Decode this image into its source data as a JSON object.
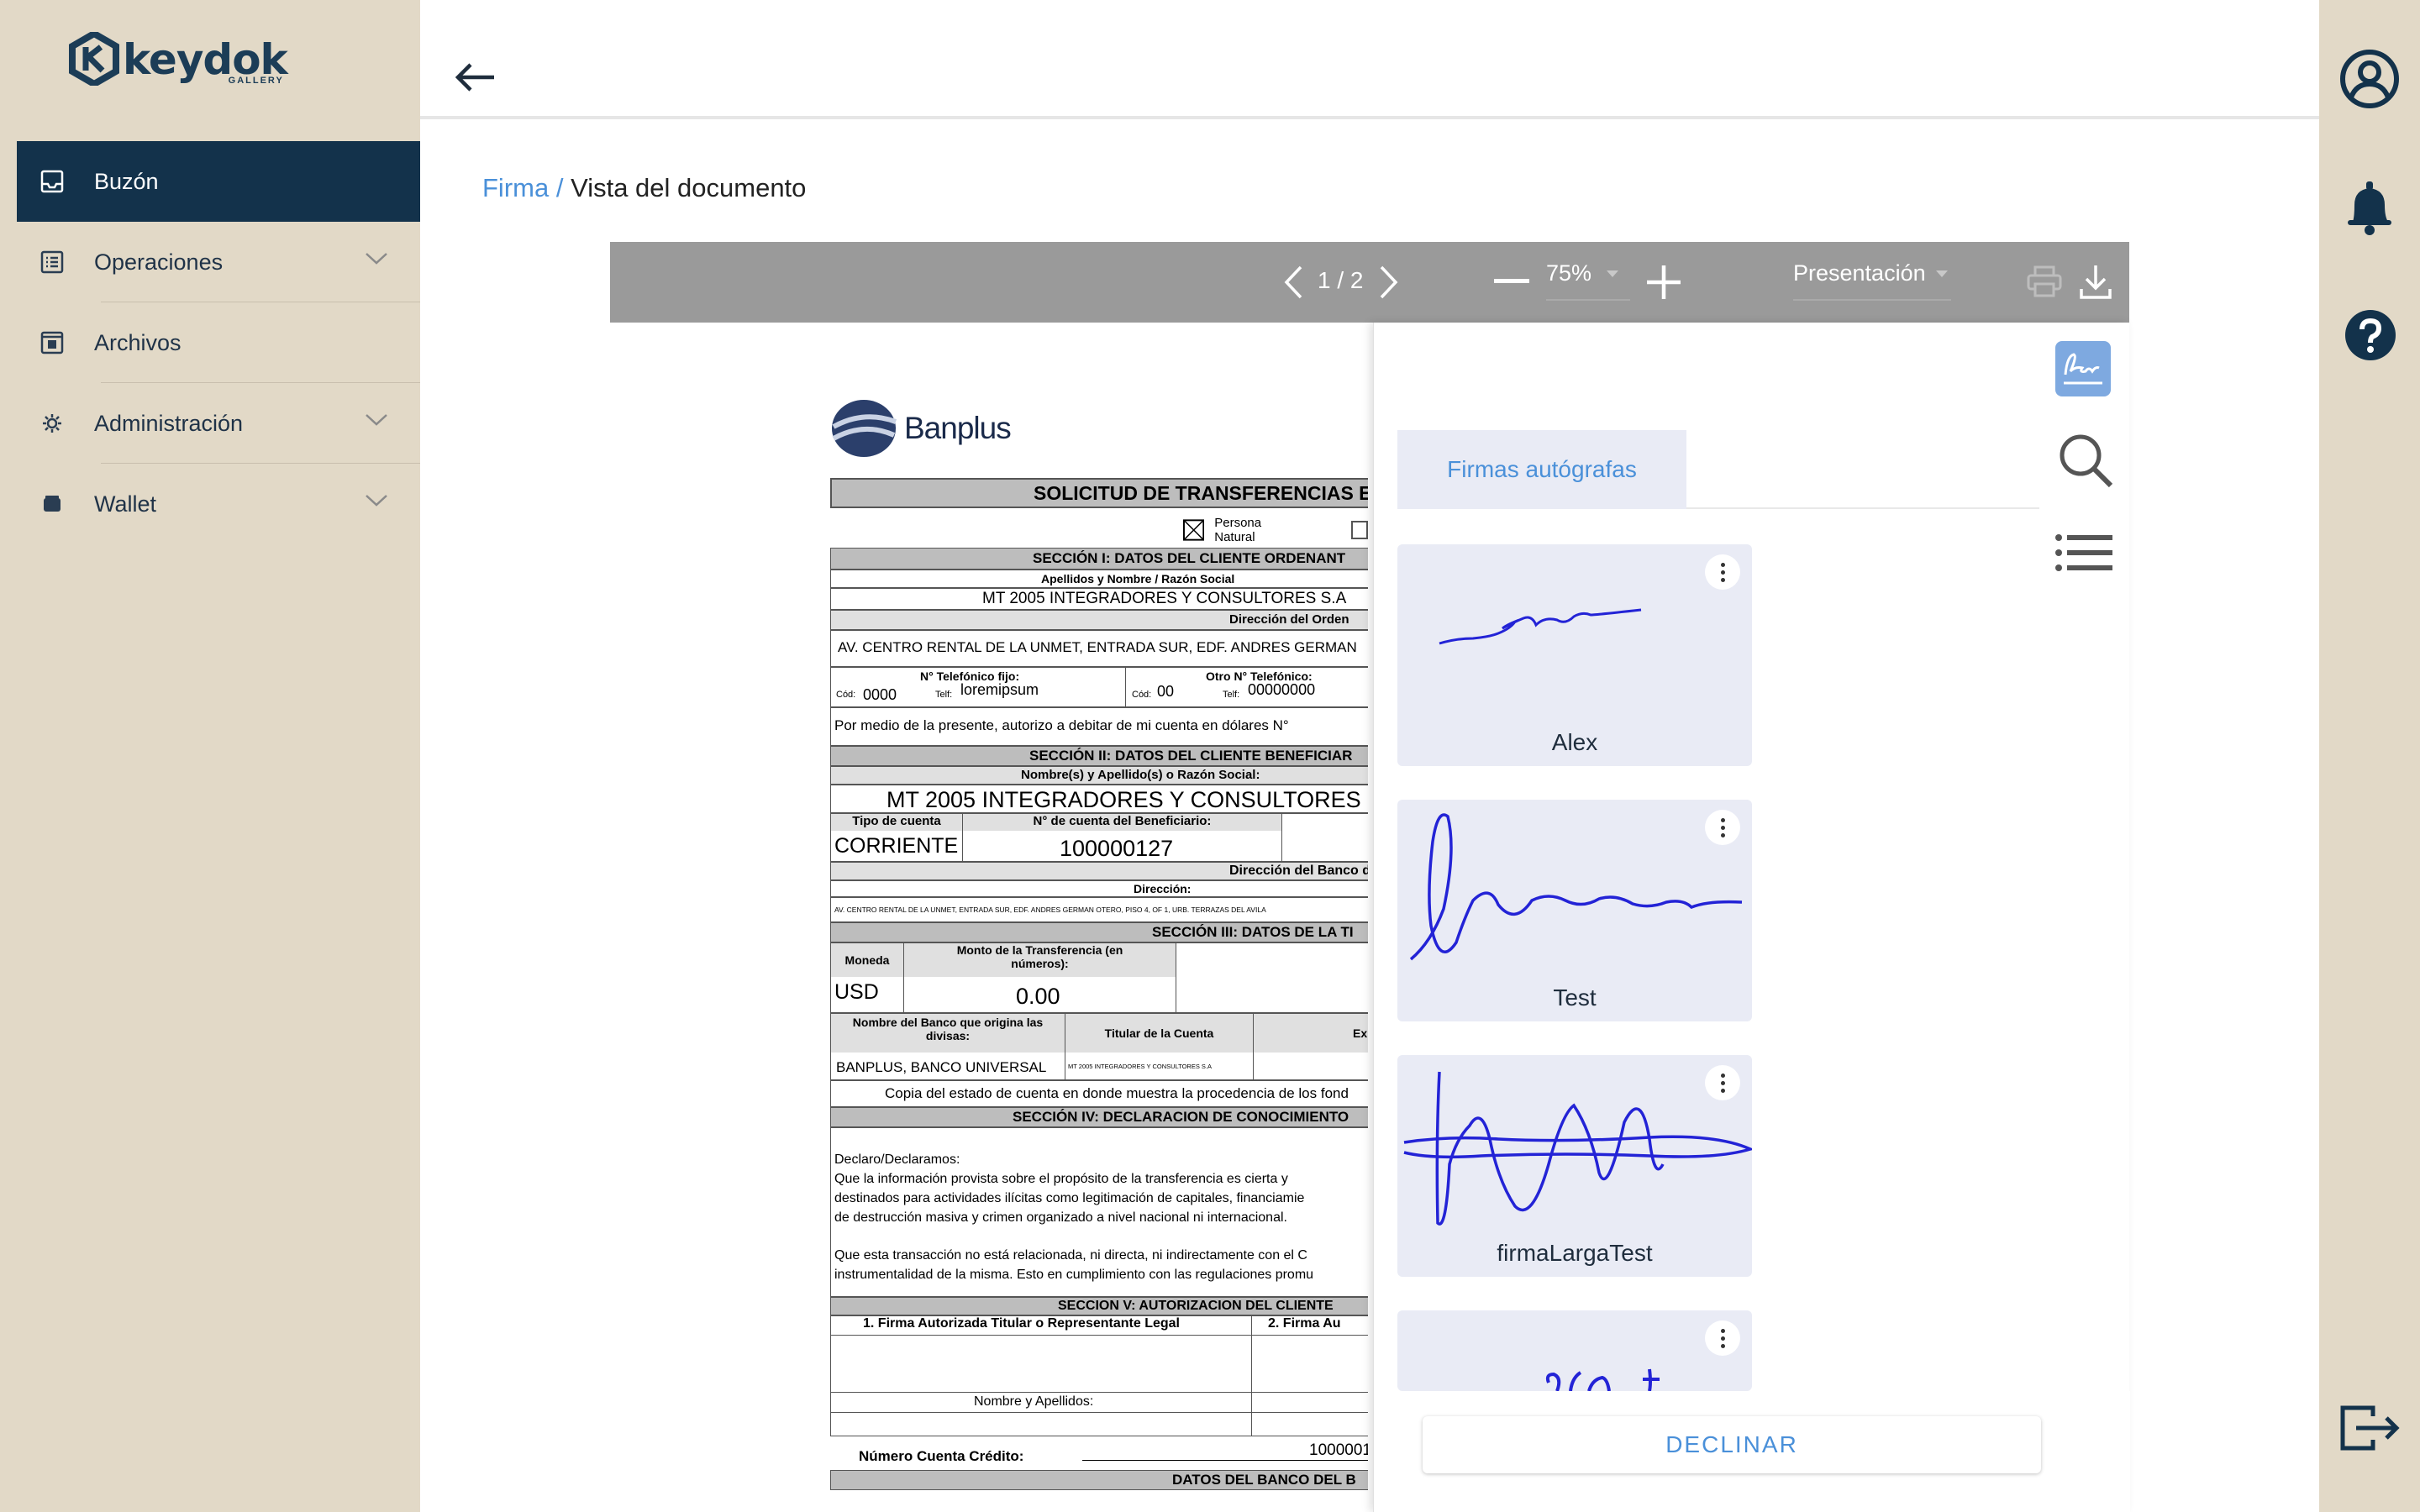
{
  "app": {
    "logo_text": "keydok",
    "logo_sub": "GALLERY"
  },
  "sidebar": {
    "items": [
      {
        "label": "Buzón",
        "icon": "inbox-icon",
        "active": true,
        "expandable": false
      },
      {
        "label": "Operaciones",
        "icon": "list-icon",
        "active": false,
        "expandable": true
      },
      {
        "label": "Archivos",
        "icon": "folder-icon",
        "active": false,
        "expandable": false
      },
      {
        "label": "Administración",
        "icon": "gear-icon",
        "active": false,
        "expandable": true
      },
      {
        "label": "Wallet",
        "icon": "wallet-icon",
        "active": false,
        "expandable": true
      }
    ]
  },
  "breadcrumb": {
    "parent": "Firma",
    "separator": " /",
    "current": "Vista del documento"
  },
  "viewer": {
    "page_indicator": "1 / 2",
    "zoom": "75%",
    "view_mode": "Presentación",
    "colors": {
      "toolbar": "#9a9a9a",
      "accent": "#4a90d9",
      "nav_active": "#13324b"
    }
  },
  "document": {
    "bank": "Banplus",
    "title": "SOLICITUD DE TRANSFERENCIAS EN",
    "persona": "Persona Natural",
    "s1": "SECCIÓN I: DATOS DEL CLIENTE ORDENANT",
    "apellidos_label": "Apellidos y Nombre / Razón Social",
    "ordenante": "MT 2005 INTEGRADORES Y CONSULTORES S.A",
    "direccion_label": "Dirección del Orden",
    "direccion": "AV. CENTRO RENTAL DE LA UNMET, ENTRADA SUR, EDF. ANDRES GERMAN",
    "tel_fijo_label": "N° Telefónico fijo:",
    "otro_tel_label": "Otro N° Telefónico:",
    "cod1": "0000",
    "tel1": "loremipsum",
    "cod2": "00",
    "tel2": "00000000",
    "cod_label": "Cód:",
    "telf_label": "Telf:",
    "autoriza": "Por medio de la presente, autorizo a debitar de mi cuenta en dólares N°",
    "s2": "SECCIÓN II: DATOS  DEL CLIENTE BENEFICIAR",
    "nombre_label": "Nombre(s) y Apellido(s) o Razón Social:",
    "beneficiario": "MT 2005 INTEGRADORES Y CONSULTORES",
    "tipo_label": "Tipo de cuenta",
    "cuenta_label": "N° de cuenta del Beneficiario:",
    "tipo": "CORRIENTE",
    "cuenta": "100000127",
    "dir_banco_label": "Dirección del Banco del B",
    "dir_label": "Dirección:",
    "dir_small": "AV. CENTRO RENTAL DE LA UNMET, ENTRADA SUR, EDF. ANDRES GERMAN OTERO, PISO 4, OF 1, URB. TERRAZAS DEL AVILA",
    "s3": "SECCIÓN III: DATOS  DE LA TI",
    "moneda_label": "Moneda",
    "monto_label": "Monto de la Transferencia (en números):",
    "moneda": "USD",
    "monto": "0.00",
    "banco_origen_label": "Nombre del Banco que origina las divisas:",
    "titular_label": "Titular de la Cuenta",
    "exp_label": "Exp",
    "banco_origen": "BANPLUS, BANCO UNIVERSAL",
    "titular": "MT 2005 INTEGRADORES Y CONSULTORES S.A",
    "copia": "Copia del estado de cuenta en donde muestra la procedencia de los fond",
    "s4": "SECCIÓN IV: DECLARACION DE CONOCIMIENTO",
    "decl1": "Declaro/Declaramos:",
    "decl2": "Que la información provista sobre el propósito de la transferencia es cierta y",
    "decl3": "destinados para actividades ilícitas como legitimación de capitales, financiamie",
    "decl4": "de destrucción masiva y crimen organizado a nivel nacional ni internacional.",
    "decl5": "Que esta transacción no está relacionada, ni directa, ni indirectamente con el C",
    "decl6": "instrumentalidad de la misma. Esto en cumplimiento con las regulaciones promu",
    "s5": "SECCION V: AUTORIZACION DEL CLIENTE",
    "firma1_label": "1. Firma Autorizada Titular o Representante Legal",
    "firma2_label": "2. Firma Au",
    "nombre_ap_label": "Nombre y Apellidos:",
    "num_credito_label": "Número Cuenta Crédito:",
    "num_credito": "1000001",
    "s6": "DATOS  DEL BANCO DEL B"
  },
  "panel": {
    "tab_label": "Firmas autógrafas",
    "signatures": [
      {
        "name": "Alex"
      },
      {
        "name": "Test"
      },
      {
        "name": "firmaLargaTest"
      },
      {
        "name": ""
      }
    ],
    "decline_label": "DECLINAR"
  }
}
